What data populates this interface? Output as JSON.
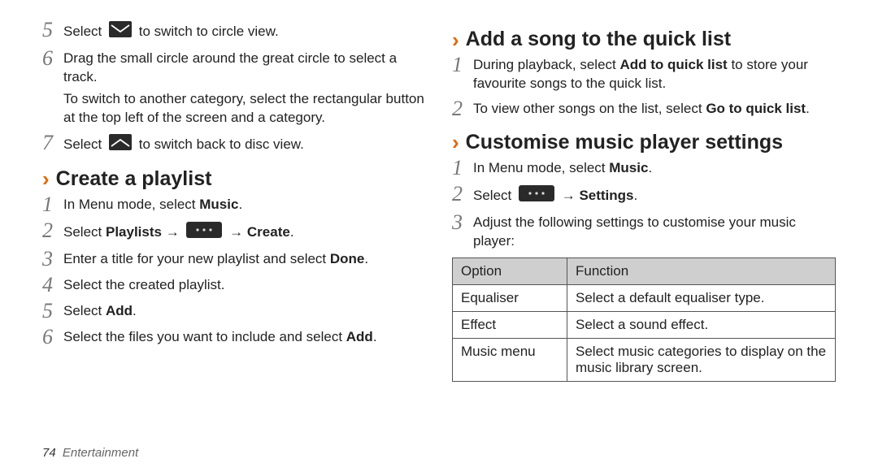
{
  "left": {
    "steps_top": [
      {
        "num": "5",
        "body_before": "Select ",
        "icon": "envelope-down",
        "body_after": " to switch to circle view."
      },
      {
        "num": "6",
        "body": "Drag the small circle around the great circle to select a track.",
        "sub": "To switch to another category, select the rectangular button at the top left of the screen and a category."
      },
      {
        "num": "7",
        "body_before": "Select ",
        "icon": "envelope-up",
        "body_after": " to switch back to disc view."
      }
    ],
    "heading": "Create a playlist",
    "steps": [
      {
        "num": "1",
        "body_before": "In Menu mode, select ",
        "bold": "Music",
        "body_after": "."
      },
      {
        "num": "2",
        "body_before": "Select ",
        "bold": "Playlists",
        "arrow1": " → ",
        "icon": "dots",
        "arrow2": " → ",
        "bold2": "Create",
        "body_after": "."
      },
      {
        "num": "3",
        "body_before": "Enter a title for your new playlist and select ",
        "bold": "Done",
        "body_after": "."
      },
      {
        "num": "4",
        "body": "Select the created playlist."
      },
      {
        "num": "5",
        "body_before": "Select ",
        "bold": "Add",
        "body_after": "."
      },
      {
        "num": "6",
        "body_before": "Select the files you want to include and select ",
        "bold": "Add",
        "body_after": "."
      }
    ]
  },
  "right": {
    "heading1": "Add a song to the quick list",
    "steps1": [
      {
        "num": "1",
        "body_before": "During playback, select ",
        "bold": "Add to quick list",
        "body_after": " to store your favourite songs to the quick list."
      },
      {
        "num": "2",
        "body_before": "To view other songs on the list, select ",
        "bold": "Go to quick list",
        "body_after": "."
      }
    ],
    "heading2": "Customise music player settings",
    "steps2": [
      {
        "num": "1",
        "body_before": "In Menu mode, select ",
        "bold": "Music",
        "body_after": "."
      },
      {
        "num": "2",
        "body_before": "Select ",
        "icon": "dots",
        "arrow": " → ",
        "bold": "Settings",
        "body_after": "."
      },
      {
        "num": "3",
        "body": "Adjust the following settings to customise your music player:"
      }
    ],
    "table": {
      "headers": [
        "Option",
        "Function"
      ],
      "rows": [
        [
          "Equaliser",
          "Select a default equaliser type."
        ],
        [
          "Effect",
          "Select a sound effect."
        ],
        [
          "Music menu",
          "Select music categories to display on the music library screen."
        ]
      ]
    }
  },
  "footer": {
    "page": "74",
    "section": "Entertainment"
  }
}
